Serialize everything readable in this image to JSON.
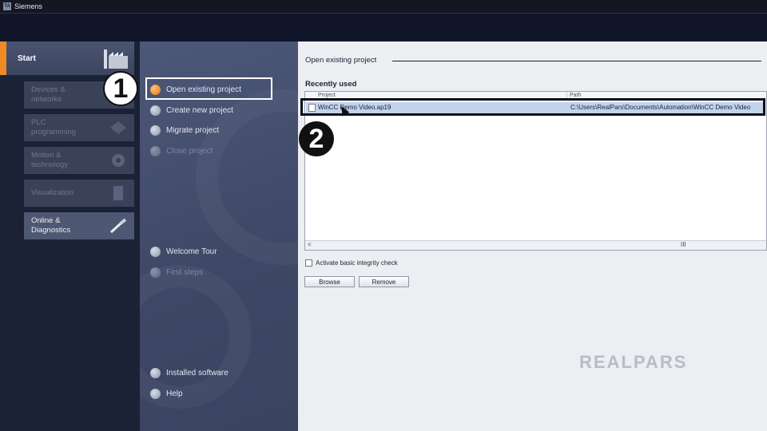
{
  "window": {
    "title": "Siemens"
  },
  "portal_nav": [
    {
      "label": "Start",
      "active": true
    },
    {
      "label": "Devices & networks",
      "line1": "Devices &",
      "line2": "networks",
      "enabled": false
    },
    {
      "label": "PLC programming",
      "line1": "PLC",
      "line2": "programming",
      "enabled": false
    },
    {
      "label": "Motion & technology",
      "line1": "Motion &",
      "line2": "technology",
      "enabled": false
    },
    {
      "label": "Visualization",
      "line1": "Visualization",
      "line2": "",
      "enabled": false
    },
    {
      "label": "Online & Diagnostics",
      "line1": "Online &",
      "line2": "Diagnostics",
      "enabled": true
    }
  ],
  "actions": [
    {
      "label": "Open existing project",
      "selected": true,
      "enabled": true
    },
    {
      "label": "Create new project",
      "enabled": true
    },
    {
      "label": "Migrate project",
      "enabled": true
    },
    {
      "label": "Close project",
      "enabled": false
    },
    {
      "label": "Welcome Tour",
      "enabled": true
    },
    {
      "label": "First steps",
      "enabled": false
    },
    {
      "label": "Installed software",
      "enabled": true
    },
    {
      "label": "Help",
      "enabled": true
    }
  ],
  "annotations": {
    "badge1": "1",
    "badge2": "2"
  },
  "content": {
    "section_title": "Open existing project",
    "recent_label": "Recently used",
    "columns": [
      "Project",
      "Path"
    ],
    "rows": [
      {
        "project": "WinCC Demo Video.ap19",
        "path": "C:\\Users\\RealPars\\Documents\\Automation\\WinCC Demo Video"
      }
    ],
    "scroll_left": "<",
    "scroll_thumb": "III",
    "integrity_check_label": "Activate basic integrity check",
    "integrity_check_checked": false,
    "browse_label": "Browse",
    "remove_label": "Remove"
  },
  "watermark": "REALPARS",
  "colors": {
    "accent": "#f08a24",
    "selection": "#c2d3ec",
    "pane": "#eceef2"
  }
}
